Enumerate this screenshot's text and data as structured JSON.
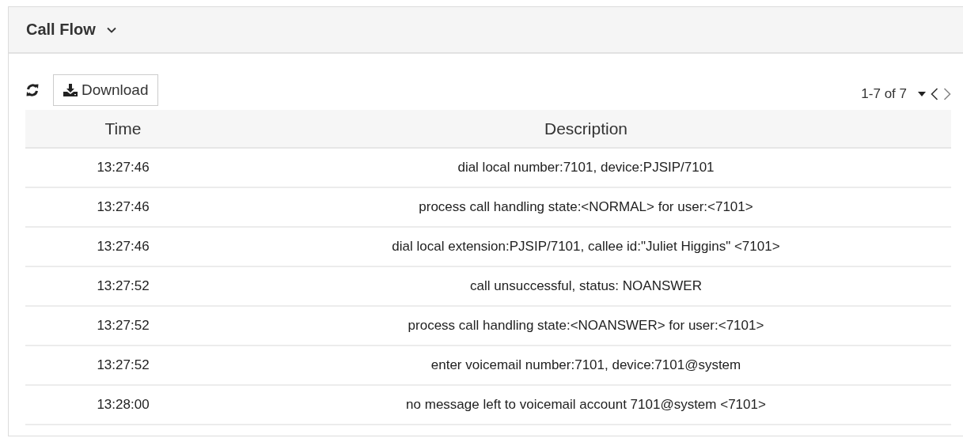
{
  "panel": {
    "title": "Call Flow",
    "expanded": true
  },
  "toolbar": {
    "download": "Download",
    "pager": {
      "range": "1-7 of 7",
      "prev_disabled": false,
      "next_disabled": true
    }
  },
  "table": {
    "columns": [
      "Time",
      "Description"
    ],
    "rows": [
      {
        "time": "13:27:46",
        "description": "dial local number:7101, device:PJSIP/7101"
      },
      {
        "time": "13:27:46",
        "description": "process call handling state:<NORMAL> for user:<7101>"
      },
      {
        "time": "13:27:46",
        "description": "dial local extension:PJSIP/7101, callee id:\"Juliet Higgins\" <7101>"
      },
      {
        "time": "13:27:52",
        "description": "call unsuccessful, status: NOANSWER"
      },
      {
        "time": "13:27:52",
        "description": "process call handling state:<NOANSWER> for user:<7101>"
      },
      {
        "time": "13:27:52",
        "description": "enter voicemail number:7101, device:7101@system"
      },
      {
        "time": "13:28:00",
        "description": "no message left to voicemail account 7101@system <7101>"
      }
    ]
  }
}
